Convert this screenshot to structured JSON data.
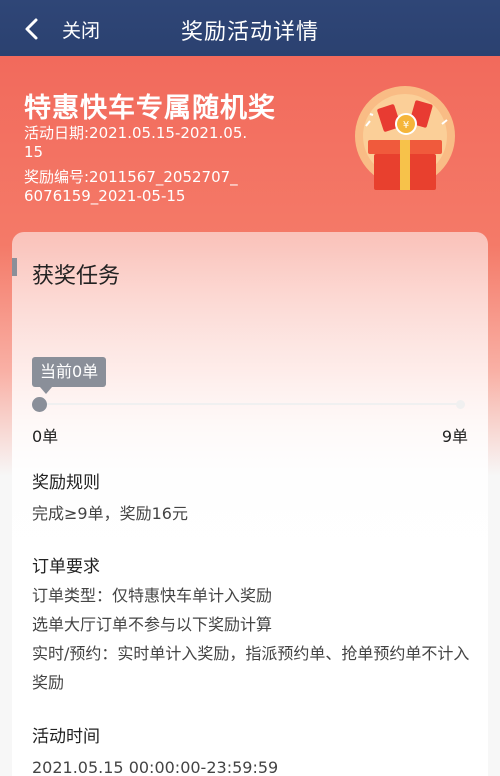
{
  "nav": {
    "close_label": "关闭",
    "title": "奖励活动详情"
  },
  "hero": {
    "title": "特惠快车专属随机奖",
    "date": "活动日期:2021.05.15-2021.05.15",
    "reward_id": "奖励编号:2011567_2052707_6076159_2021-05-15"
  },
  "task": {
    "title": "获奖任务",
    "current_label": "当前0单",
    "progress": 0,
    "start_label": "0单",
    "end_label": "9单"
  },
  "rules": {
    "heading": "奖励规则",
    "text": "完成≥9单，奖励16元"
  },
  "order_req": {
    "heading": "订单要求",
    "line1": "订单类型：仅特惠快车单计入奖励",
    "line2": "选单大厅订单不参与以下奖励计算",
    "line3": "实时/预约：实时单计入奖励，指派预约单、抢单预约单不计入奖励"
  },
  "activity_time": {
    "heading": "活动时间",
    "text": "2021.05.15 00:00:00-23:59:59"
  },
  "colors": {
    "nav_bg": "#2f4677",
    "hero_accent": "#f26a5c",
    "progress_gray": "#8a8f99"
  }
}
